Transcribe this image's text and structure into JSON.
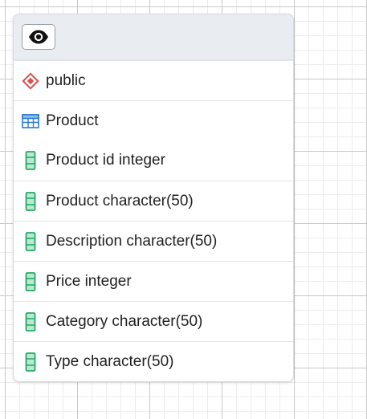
{
  "node": {
    "header": {
      "toggle_icon": "eye-icon"
    },
    "schema": {
      "icon": "schema-diamond-icon",
      "label": "public",
      "color": "#d9534f"
    },
    "table": {
      "icon": "table-grid-icon",
      "label": "Product",
      "color": "#2b7bd6"
    },
    "columns": [
      {
        "icon": "column-icon",
        "label": "Product id integer"
      },
      {
        "icon": "column-icon",
        "label": "Product character(50)"
      },
      {
        "icon": "column-icon",
        "label": "Description character(50)"
      },
      {
        "icon": "column-icon",
        "label": "Price integer"
      },
      {
        "icon": "column-icon",
        "label": "Category character(50)"
      },
      {
        "icon": "column-icon",
        "label": "Type character(50)"
      }
    ],
    "column_icon_color": "#27a86a"
  }
}
